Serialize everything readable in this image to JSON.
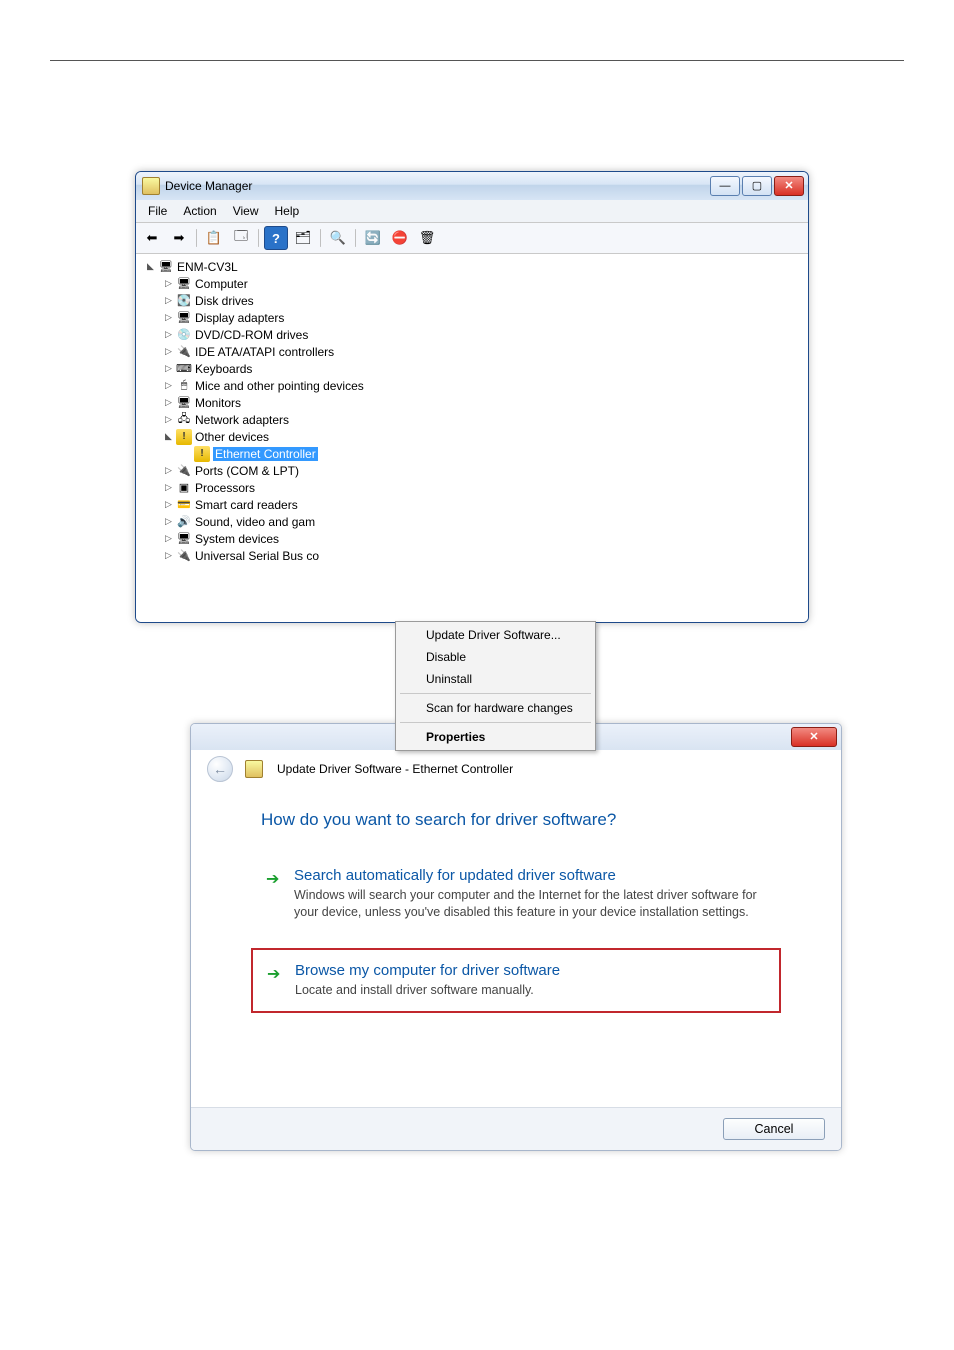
{
  "dm": {
    "title": "Device Manager",
    "menus": {
      "file": "File",
      "action": "Action",
      "view": "View",
      "help": "Help"
    },
    "root": "ENM-CV3L",
    "items": [
      "Computer",
      "Disk drives",
      "Display adapters",
      "DVD/CD-ROM drives",
      "IDE ATA/ATAPI controllers",
      "Keyboards",
      "Mice and other pointing devices",
      "Monitors",
      "Network adapters"
    ],
    "other_devices": "Other devices",
    "ethernet": "Ethernet Controller",
    "items2": [
      "Ports (COM & LPT)",
      "Processors",
      "Smart card readers",
      "Sound, video and gam",
      "System devices",
      "Universal Serial Bus co"
    ],
    "ctx": {
      "update": "Update Driver Software...",
      "disable": "Disable",
      "uninstall": "Uninstall",
      "scan": "Scan for hardware changes",
      "properties": "Properties"
    }
  },
  "wiz": {
    "title": "Update Driver Software - Ethernet Controller",
    "heading": "How do you want to search for driver software?",
    "opt1": {
      "title": "Search automatically for updated driver software",
      "desc": "Windows will search your computer and the Internet for the latest driver software for your device, unless you've disabled this feature in your device installation settings."
    },
    "opt2": {
      "title": "Browse my computer for driver software",
      "desc": "Locate and install driver software manually."
    },
    "cancel": "Cancel"
  }
}
